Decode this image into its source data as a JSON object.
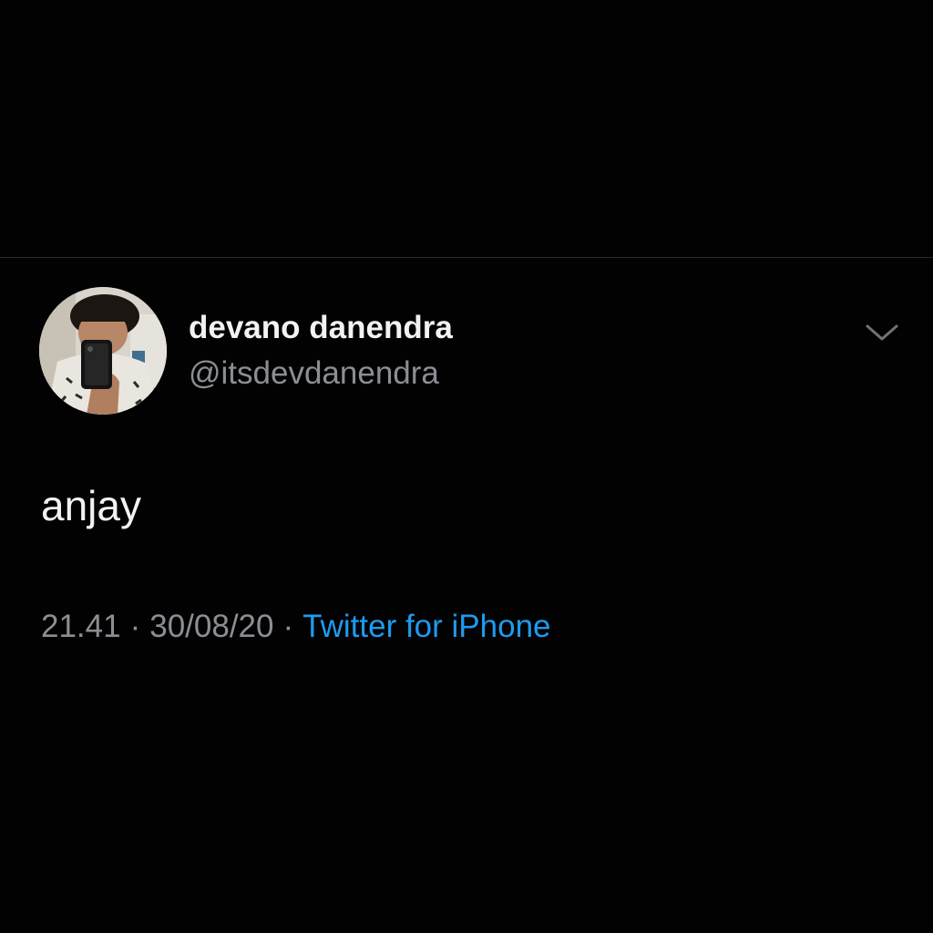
{
  "tweet": {
    "author": {
      "display_name": "devano danendra",
      "handle": "@itsdevdanendra",
      "avatar": "profile-photo"
    },
    "menu_icon": "chevron-down-icon",
    "text": "anjay",
    "time": "21.41",
    "separator": "·",
    "date": "30/08/20",
    "source": "Twitter for iPhone"
  },
  "colors": {
    "background": "#000000",
    "text_primary": "#f2f2f2",
    "text_secondary": "#8b8f94",
    "link": "#1d9bf0",
    "divider": "#2b2b2b"
  }
}
